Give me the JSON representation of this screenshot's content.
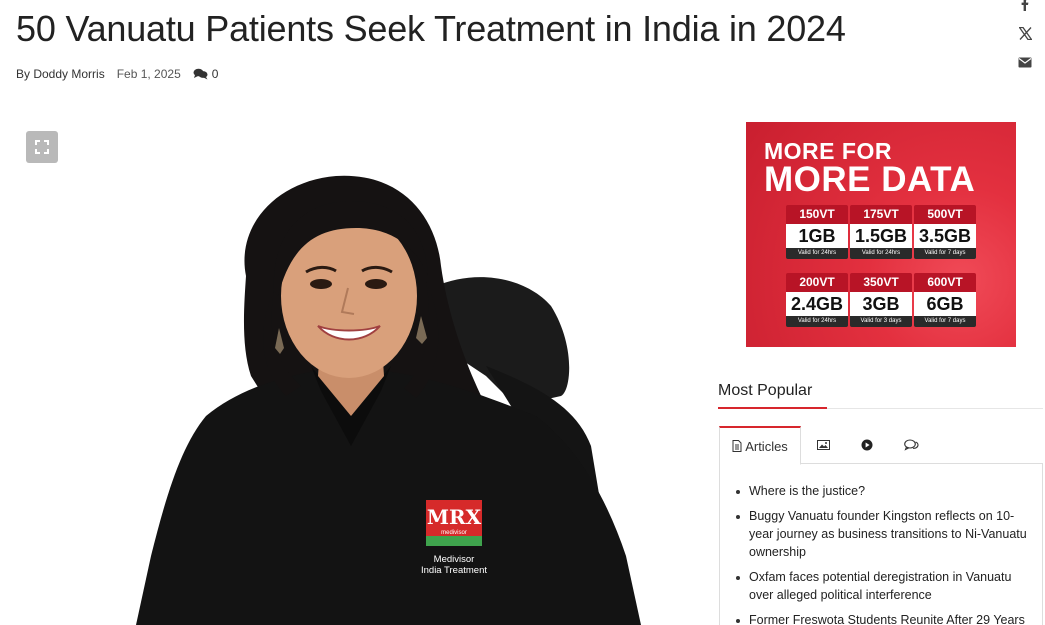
{
  "article": {
    "title": "50 Vanuatu Patients Seek Treatment in India in 2024",
    "byline": "By Doddy Morris",
    "date": "Feb 1, 2025",
    "comment_count": "0"
  },
  "share_icons": [
    "facebook-icon",
    "x-icon",
    "email-icon"
  ],
  "hero": {
    "logo_mark": "MRX",
    "logo_sub": "medivisor",
    "caption_line1": "Medivisor",
    "caption_line2": "India Treatment"
  },
  "ad": {
    "headline_top": "MORE FOR",
    "headline_bottom": "MORE DATA",
    "plans": [
      {
        "price": "150VT",
        "data": "1GB",
        "valid": "Valid for 24hrs"
      },
      {
        "price": "175VT",
        "data": "1.5GB",
        "valid": "Valid for 24hrs"
      },
      {
        "price": "500VT",
        "data": "3.5GB",
        "valid": "Valid for 7 days"
      },
      {
        "price": "200VT",
        "data": "2.4GB",
        "valid": "Valid for 24hrs"
      },
      {
        "price": "350VT",
        "data": "3GB",
        "valid": "Valid for 3 days"
      },
      {
        "price": "600VT",
        "data": "6GB",
        "valid": "Valid for 7 days"
      }
    ]
  },
  "popular": {
    "title": "Most Popular",
    "tabs": [
      {
        "label": "Articles",
        "icon": "document-icon"
      },
      {
        "label": "",
        "icon": "image-icon"
      },
      {
        "label": "",
        "icon": "play-icon"
      },
      {
        "label": "",
        "icon": "comments-icon"
      }
    ],
    "items": [
      "Where is the justice?",
      "Buggy Vanuatu founder Kingston reflects on 10-year journey as business transitions to Ni-Vanuatu ownership",
      "Oxfam faces potential deregistration in Vanuatu over alleged political interference",
      "Former Freswota Students Reunite After 29 Years"
    ]
  },
  "colors": {
    "accent": "#d7262d",
    "ad_red": "#e3303f"
  }
}
